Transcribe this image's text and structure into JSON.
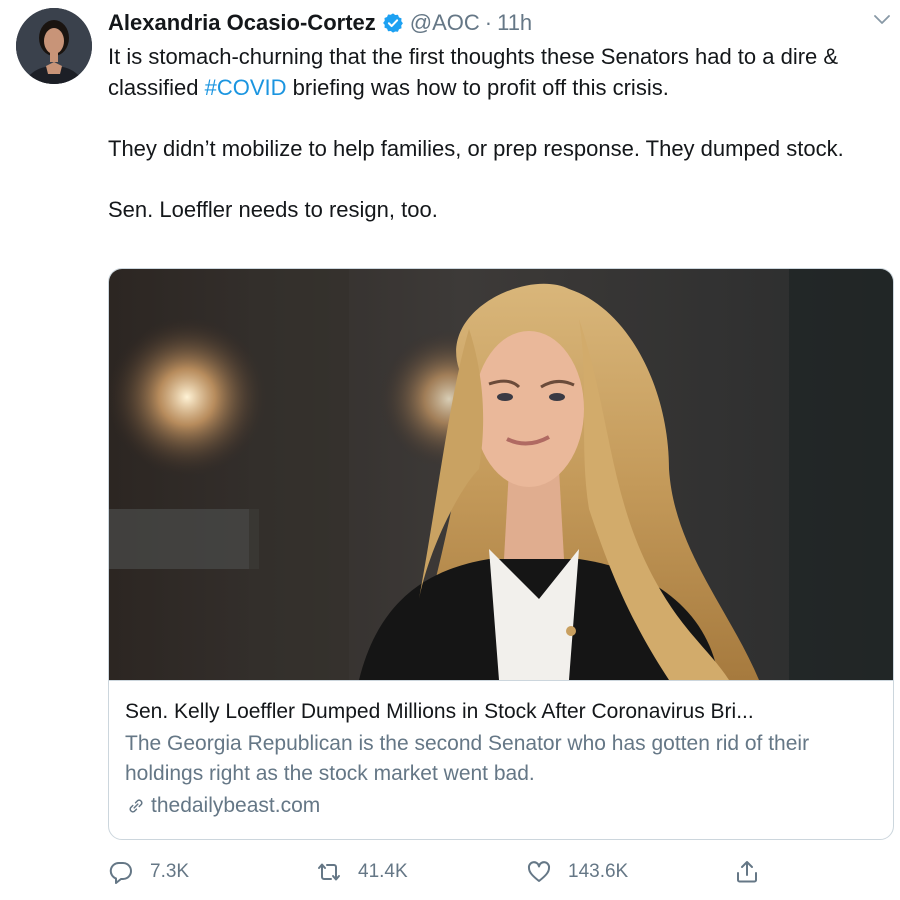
{
  "tweet": {
    "author_name": "Alexandria Ocasio-Cortez",
    "handle": "@AOC",
    "separator": "·",
    "time": "11h",
    "verified": true,
    "text_line1_before": "It is stomach-churning that the first thoughts these Senators had to a dire & classified ",
    "hashtag": "#COVID",
    "text_line1_after": " briefing was how to profit off this crisis.",
    "text_para2": "They didn’t mobilize to help families, or prep response. They dumped stock.",
    "text_para3": "Sen. Loeffler needs to resign, too."
  },
  "card": {
    "title": "Sen. Kelly Loeffler Dumped Millions in Stock After Coronavirus Bri...",
    "description": "The Georgia Republican is the second Senator who has gotten rid of their holdings right as the stock market went bad.",
    "domain": "thedailybeast.com",
    "link_icon": "link-icon"
  },
  "actions": {
    "reply_count": "7.3K",
    "retweet_count": "41.4K",
    "like_count": "143.6K",
    "reply_icon": "reply-icon",
    "retweet_icon": "retweet-icon",
    "like_icon": "heart-icon",
    "share_icon": "share-icon"
  },
  "colors": {
    "hashtag": "#1b95e0",
    "verified": "#1da1f2",
    "secondary_text": "#657786",
    "border": "#ccd6dd"
  }
}
